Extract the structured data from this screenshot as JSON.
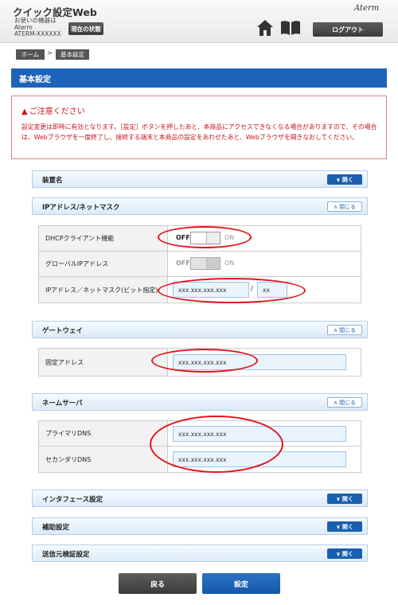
{
  "header": {
    "app_title": "クイック設定Web",
    "device_label": "お使いの機器は",
    "device_name": "Aterm",
    "device_id": "ATERM-XXXXXX",
    "status_button": "現在の状態",
    "brand": "Aterm",
    "logout_button": "ログアウト"
  },
  "breadcrumb": {
    "home": "ホーム",
    "separator": ">",
    "current": "基本設定"
  },
  "page_title": "基本設定",
  "notice": {
    "title": "ご注意ください",
    "body": "設定変更は即時に有効となります。［設定］ボタンを押したあと、本商品にアクセスできなくなる場合がありますので、その場合は、Webブラウザを一度終了し、接続する端末と本商品の設定をあわせたあと、Webブラウザを開きなおしてください。"
  },
  "buttons": {
    "open": "開く",
    "close": "閉じる",
    "back": "戻る",
    "apply": "設定"
  },
  "sections": {
    "device_name": {
      "label": "装置名"
    },
    "ip": {
      "label": "IPアドレス/ネットマスク",
      "dhcp_label": "DHCPクライアント機能",
      "global_ip_label": "グローバルIPアドレス",
      "ip_mask_label": "IPアドレス／ネットマスク(ビット指定)",
      "toggle_off": "OFF",
      "toggle_on": "ON",
      "ip_value": "xxx.xxx.xxx.xxx",
      "slash": "/",
      "mask_value": "xx"
    },
    "gateway": {
      "label": "ゲートウェイ",
      "fixed_label": "固定アドレス",
      "fixed_value": "xxx.xxx.xxx.xxx"
    },
    "dns": {
      "label": "ネームサーバ",
      "primary_label": "プライマリDNS",
      "primary_value": "xxx.xxx.xxx.xxx",
      "secondary_label": "セカンダリDNS",
      "secondary_value": "xxx.xxx.xxx.xxx"
    },
    "interface": {
      "label": "インタフェース設定"
    },
    "aux": {
      "label": "補助設定"
    },
    "source_verify": {
      "label": "送信元検証設定"
    }
  },
  "colors": {
    "accent": "#1e63b8",
    "warning": "#c8141a",
    "annotation": "#e3141b"
  }
}
